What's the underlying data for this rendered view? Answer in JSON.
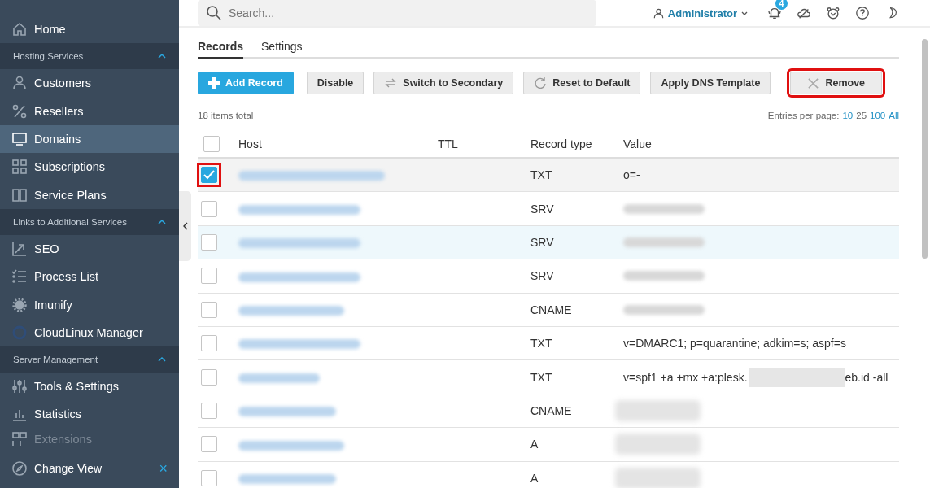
{
  "sidebar": {
    "items": [
      {
        "kind": "item",
        "label": "Home",
        "selected": false
      },
      {
        "kind": "section",
        "label": "Hosting Services",
        "expanded": true
      },
      {
        "kind": "item",
        "label": "Customers",
        "selected": false
      },
      {
        "kind": "item",
        "label": "Resellers",
        "selected": false
      },
      {
        "kind": "item",
        "label": "Domains",
        "selected": true
      },
      {
        "kind": "item",
        "label": "Subscriptions",
        "selected": false
      },
      {
        "kind": "item",
        "label": "Service Plans",
        "selected": false
      },
      {
        "kind": "section",
        "label": "Links to Additional Services",
        "expanded": true
      },
      {
        "kind": "item",
        "label": "SEO",
        "selected": false
      },
      {
        "kind": "item",
        "label": "Process List",
        "selected": false
      },
      {
        "kind": "item",
        "label": "Imunify",
        "selected": false
      },
      {
        "kind": "item",
        "label": "CloudLinux Manager",
        "selected": false
      },
      {
        "kind": "section",
        "label": "Server Management",
        "expanded": true
      },
      {
        "kind": "item",
        "label": "Tools & Settings",
        "selected": false
      },
      {
        "kind": "item",
        "label": "Statistics",
        "selected": false
      },
      {
        "kind": "item",
        "label": "Extensions",
        "selected": false,
        "faded": true
      }
    ],
    "footer": {
      "label": "Change View",
      "close": "×"
    }
  },
  "topbar": {
    "search": {
      "placeholder": "Search..."
    },
    "user": "Administrator",
    "notifications": "4"
  },
  "tabs": [
    {
      "label": "Records",
      "selected": true
    },
    {
      "label": "Settings",
      "selected": false
    }
  ],
  "toolbar": [
    {
      "label": "Add Record",
      "kind": "primary",
      "annotated": false
    },
    {
      "label": "Disable",
      "kind": "plain",
      "annotated": false
    },
    {
      "label": "Switch to Secondary",
      "kind": "switch",
      "annotated": false
    },
    {
      "label": "Reset to Default",
      "kind": "reset",
      "annotated": false
    },
    {
      "label": "Apply DNS Template",
      "kind": "plain",
      "annotated": false
    },
    {
      "label": "Remove",
      "kind": "remove",
      "annotated": true
    }
  ],
  "summary": "18 items total",
  "pager": {
    "label": "Entries per page:",
    "options": [
      {
        "label": "10",
        "selected": false
      },
      {
        "label": "25",
        "selected": true
      },
      {
        "label": "100",
        "selected": false
      },
      {
        "label": "All",
        "selected": false
      }
    ]
  },
  "table": {
    "all_checked": false,
    "columns": [
      "Host",
      "TTL",
      "Record type",
      "Value"
    ],
    "rows": [
      {
        "type": "TXT",
        "value": {
          "kind": "text",
          "text": "o=-"
        },
        "checked": true,
        "hovered": false,
        "annotated": true
      },
      {
        "type": "SRV",
        "value": {
          "kind": "blurred"
        },
        "checked": false,
        "hovered": false,
        "annotated": false
      },
      {
        "type": "SRV",
        "value": {
          "kind": "blurred"
        },
        "checked": false,
        "hovered": true,
        "annotated": false
      },
      {
        "type": "SRV",
        "value": {
          "kind": "blurred"
        },
        "checked": false,
        "hovered": false,
        "annotated": false
      },
      {
        "type": "CNAME",
        "value": {
          "kind": "blurred"
        },
        "checked": false,
        "hovered": false,
        "annotated": false
      },
      {
        "type": "TXT",
        "value": {
          "kind": "text",
          "text": "v=DMARC1; p=quarantine; adkim=s; aspf=s"
        },
        "checked": false,
        "hovered": false,
        "annotated": false
      },
      {
        "type": "TXT",
        "value": {
          "kind": "split",
          "before": "v=spf1 +a +mx +a:plesk.",
          "after": "eb.id -all"
        },
        "checked": false,
        "hovered": false,
        "annotated": false
      },
      {
        "type": "CNAME",
        "value": {
          "kind": "grey"
        },
        "checked": false,
        "hovered": false,
        "annotated": false
      },
      {
        "type": "A",
        "value": {
          "kind": "grey"
        },
        "checked": false,
        "hovered": false,
        "annotated": false
      },
      {
        "type": "A",
        "value": {
          "kind": "grey"
        },
        "checked": false,
        "hovered": false,
        "annotated": false
      }
    ]
  }
}
